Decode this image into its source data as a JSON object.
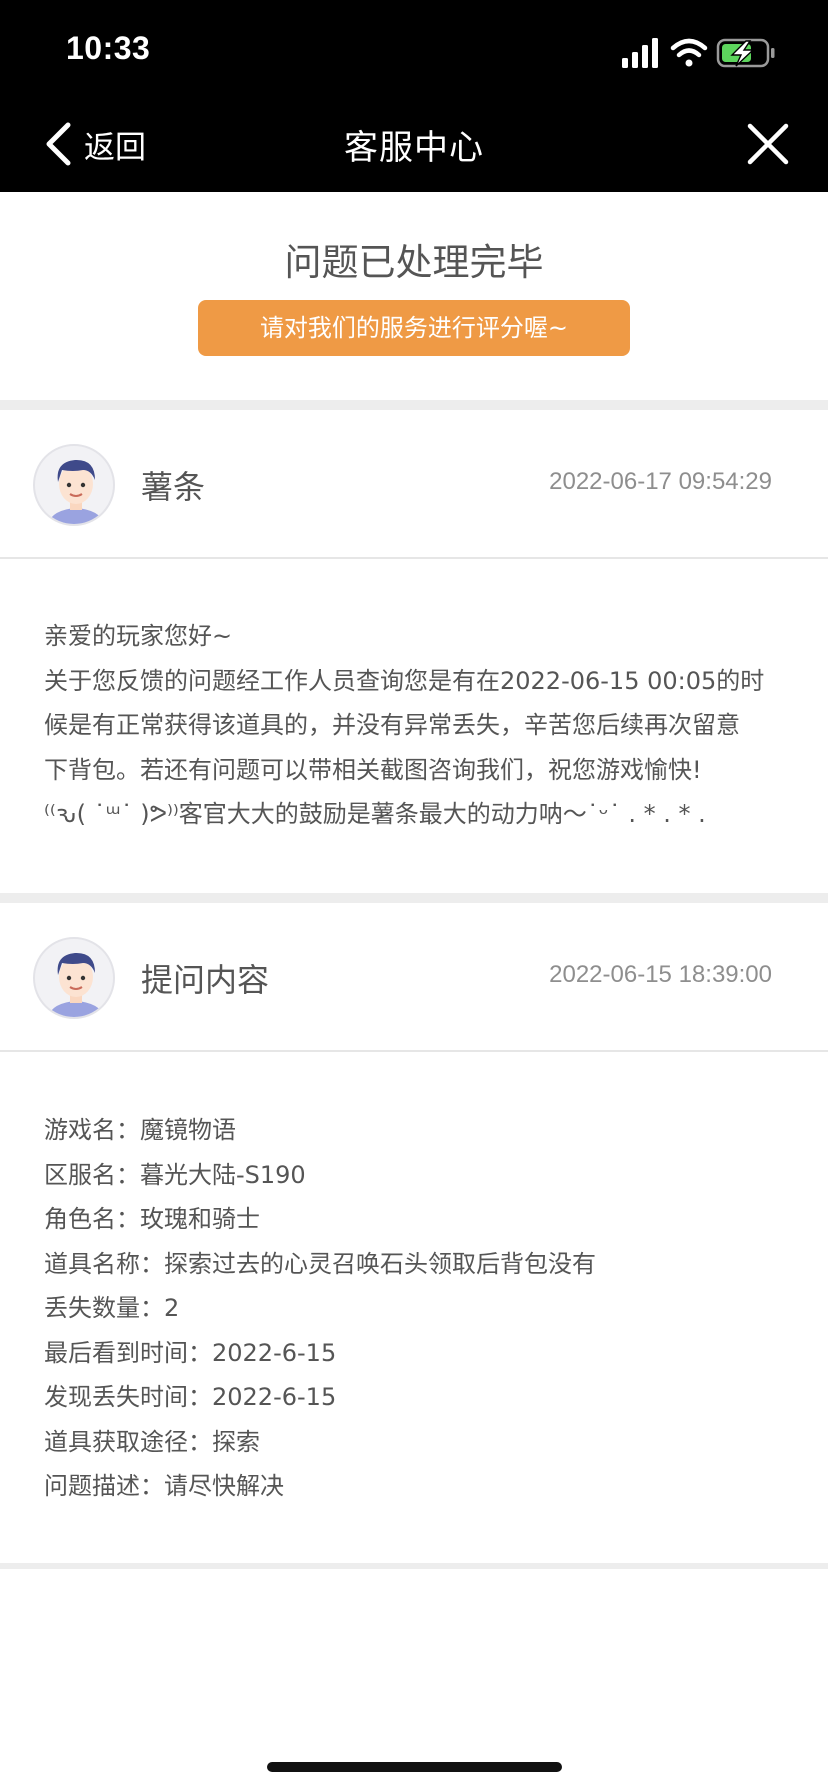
{
  "status_bar": {
    "time": "10:33",
    "icons": [
      "signal-icon",
      "wifi-icon",
      "battery-charging-icon"
    ],
    "battery_color": "#5DD55D"
  },
  "nav": {
    "back_label": "返回",
    "title": "客服中心"
  },
  "resolved": {
    "title": "问题已处理完毕",
    "rate_button": "请对我们的服务进行评分喔~",
    "accent_color": "#EF9A45"
  },
  "reply": {
    "sender": "薯条",
    "timestamp": "2022-06-17 09:54:29",
    "lines": [
      "亲爱的玩家您好~",
      "关于您反馈的问题经工作人员查询您是有在2022-06-15 00:05的时",
      "候是有正常获得该道具的，并没有异常丢失，辛苦您后续再次留意",
      "下背包。若还有问题可以带相关截图咨询我们，祝您游戏愉快!",
      "⁽⁽ԅ( ˙ᵚ˙ )ᕗ⁾⁾客官大大的鼓励是薯条最大的动力呐～˙ᵕ˙ . * . * ."
    ]
  },
  "question": {
    "sender": "提问内容",
    "timestamp": "2022-06-15 18:39:00",
    "fields": [
      {
        "label": "游戏名：",
        "value": "魔镜物语"
      },
      {
        "label": "区服名：",
        "value": "暮光大陆-S190"
      },
      {
        "label": "角色名：",
        "value": "玫瑰和骑士"
      },
      {
        "label": "道具名称：",
        "value": "探索过去的心灵召唤石头领取后背包没有"
      },
      {
        "label": "丢失数量：",
        "value": "2"
      },
      {
        "label": "最后看到时间：",
        "value": "2022-6-15"
      },
      {
        "label": "发现丢失时间：",
        "value": "2022-6-15"
      },
      {
        "label": "道具获取途径：",
        "value": "探索"
      },
      {
        "label": "问题描述：",
        "value": "请尽快解决"
      }
    ]
  }
}
